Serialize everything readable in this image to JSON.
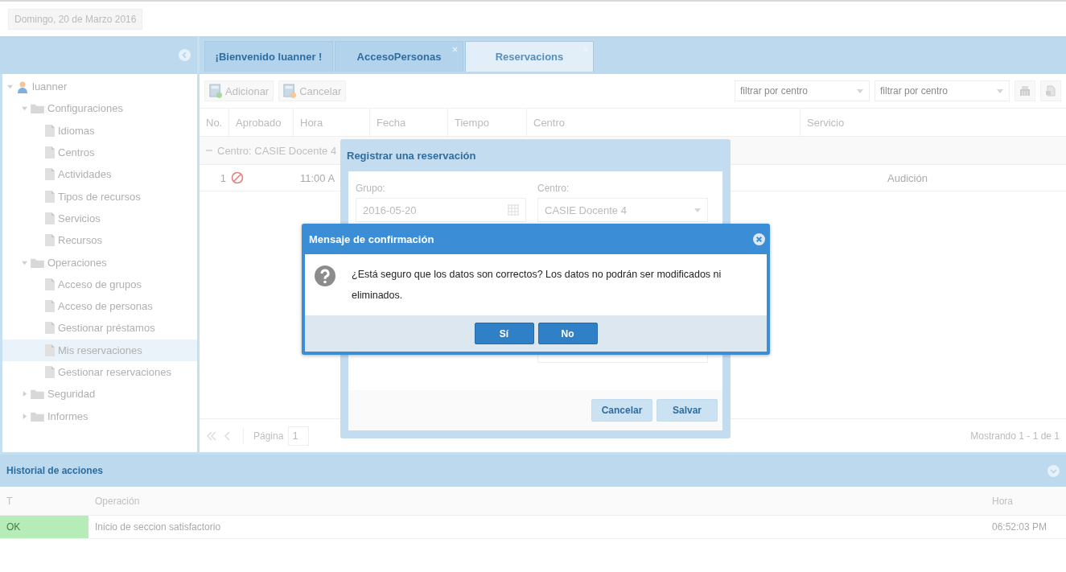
{
  "header": {
    "date": "Domingo, 20 de Marzo 2016"
  },
  "sidebar": {
    "tree": [
      {
        "label": "luanner",
        "kind": "user",
        "expanded": true,
        "selected": false,
        "children": [
          {
            "label": "Configuraciones",
            "kind": "folder",
            "expanded": true,
            "selected": false,
            "children": [
              {
                "label": "Idiomas",
                "kind": "page",
                "selected": false
              },
              {
                "label": "Centros",
                "kind": "page",
                "selected": false
              },
              {
                "label": "Actividades",
                "kind": "page",
                "selected": false
              },
              {
                "label": "Tipos de recursos",
                "kind": "page",
                "selected": false
              },
              {
                "label": "Servicios",
                "kind": "page",
                "selected": false
              },
              {
                "label": "Recursos",
                "kind": "page",
                "selected": false
              }
            ]
          },
          {
            "label": "Operaciones",
            "kind": "folder",
            "expanded": true,
            "selected": false,
            "children": [
              {
                "label": "Acceso de grupos",
                "kind": "page",
                "selected": false
              },
              {
                "label": "Acceso de personas",
                "kind": "page",
                "selected": false
              },
              {
                "label": "Gestionar préstamos",
                "kind": "page",
                "selected": false
              },
              {
                "label": "Mis reservaciones",
                "kind": "page",
                "selected": true
              },
              {
                "label": "Gestionar reservaciones",
                "kind": "page",
                "selected": false
              }
            ]
          },
          {
            "label": "Seguridad",
            "kind": "folder",
            "expanded": false,
            "selected": false
          },
          {
            "label": "Informes",
            "kind": "folder",
            "expanded": false,
            "selected": false
          }
        ]
      }
    ]
  },
  "tabs": [
    {
      "label": "¡Bienvenido luanner !",
      "selected": false,
      "closable": false
    },
    {
      "label": "AccesoPersonas",
      "selected": false,
      "closable": true
    },
    {
      "label": "Reservacions",
      "selected": true,
      "closable": true
    }
  ],
  "toolbar": {
    "buttons": [
      {
        "label": "Adicionar",
        "kind": "add"
      },
      {
        "label": "Cancelar",
        "kind": "cancel"
      }
    ],
    "filters": [
      {
        "placeholder": "filtrar por centro"
      },
      {
        "placeholder": "filtrar por centro"
      }
    ]
  },
  "grid": {
    "columns": [
      "No.",
      "Aprobado",
      "Hora",
      "Fecha",
      "Tiempo",
      "Centro",
      "Servicio"
    ],
    "group": {
      "label": "Centro: CASIE Docente 4",
      "expanded": true
    },
    "rows": [
      {
        "no": "1",
        "approved": false,
        "hora": "11:00 A",
        "servicio": "Audición"
      }
    ]
  },
  "pager": {
    "label": "Página",
    "page": "1",
    "summary": "Mostrando 1 - 1 de 1"
  },
  "history": {
    "title": "Historial de acciones",
    "columns": [
      "T",
      "Operación",
      "Hora"
    ],
    "rows": [
      {
        "type": "OK",
        "kind": "ok",
        "operation": "Inicio de seccion satisfactorio",
        "time": "06:52:03 PM"
      }
    ]
  },
  "form_window": {
    "title": "Registrar una reservación",
    "fields": [
      {
        "label": "Grupo:",
        "value": "2016-05-20",
        "kind": "date"
      },
      {
        "label": "Centro:",
        "value": "CASIE Docente 4",
        "kind": "select"
      }
    ],
    "buttons": [
      "Cancelar",
      "Salvar"
    ]
  },
  "dialog": {
    "title": "Mensaje de confirmación",
    "message": "¿Está seguro que los datos son correctos? Los datos no podrán ser modificados ni eliminados.",
    "buttons": [
      "Sí",
      "No"
    ]
  }
}
